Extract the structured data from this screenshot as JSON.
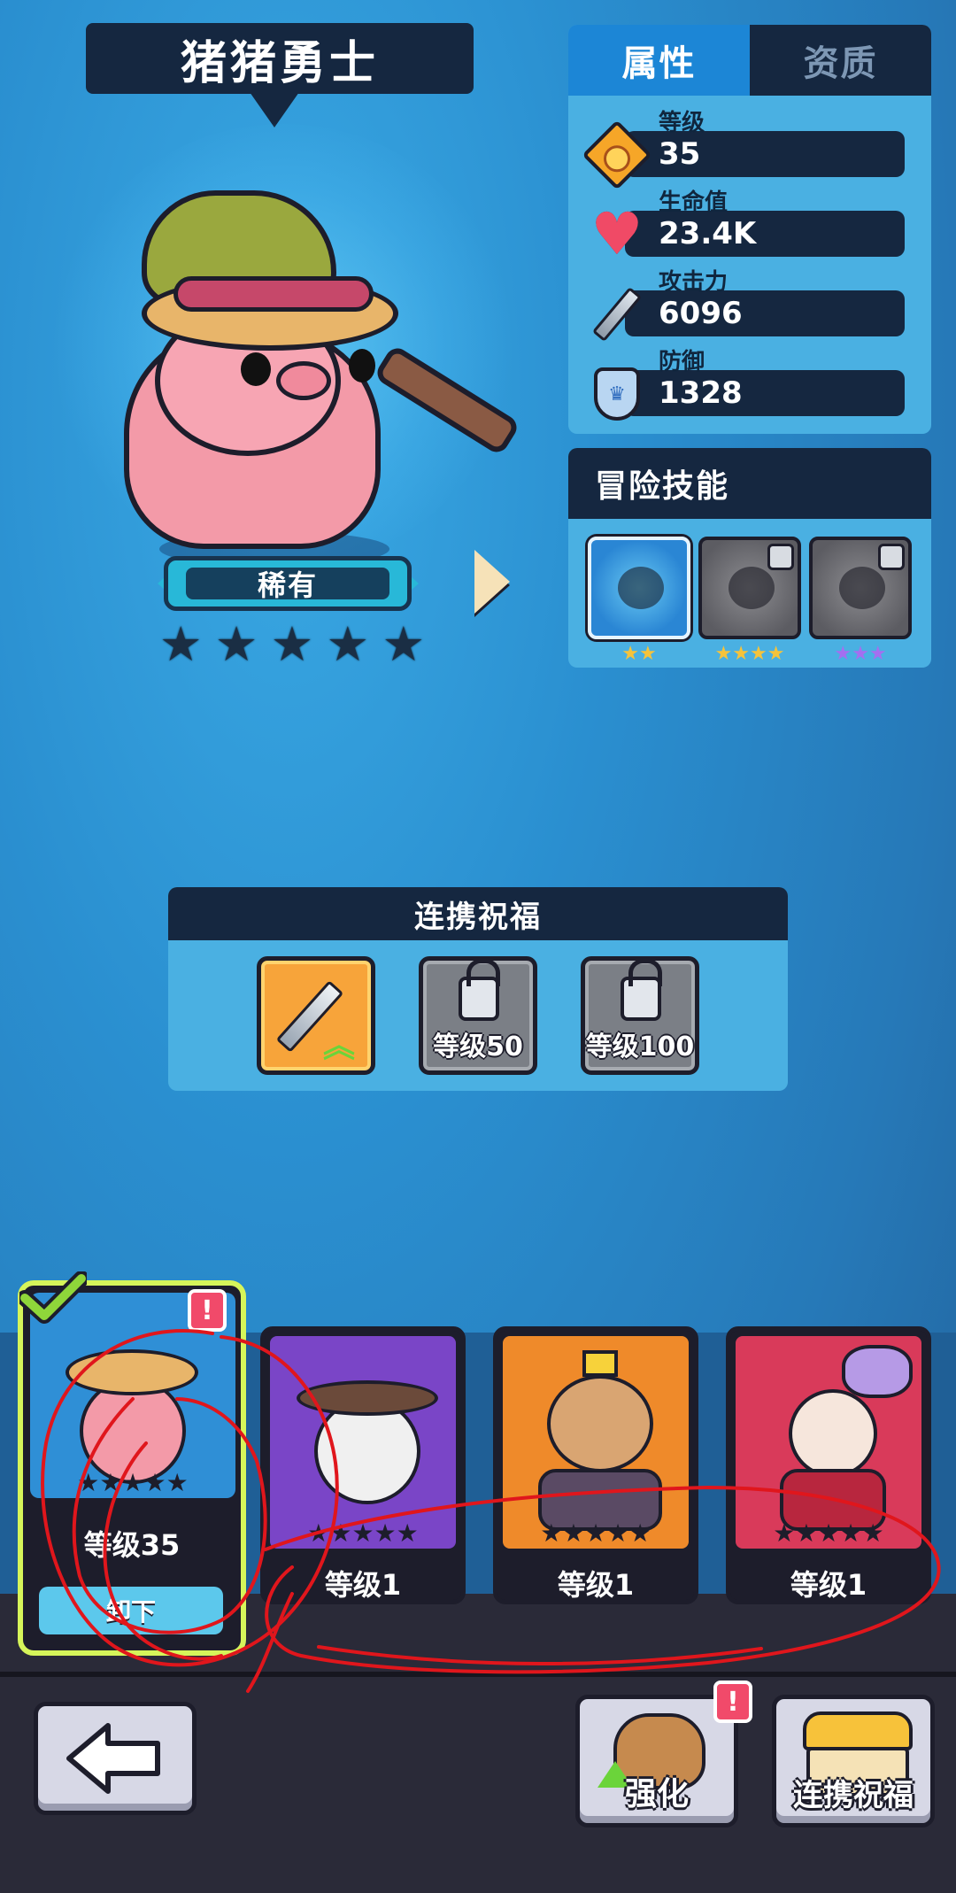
{
  "hero": {
    "name": "猪猪勇士",
    "rarity": "稀有",
    "stars_filled": 0,
    "stars_total": 5
  },
  "attributes": {
    "tabs": [
      {
        "label": "属性",
        "active": true
      },
      {
        "label": "资质",
        "active": false
      }
    ],
    "stats": [
      {
        "label": "等级",
        "value": "35",
        "icon": "level-badge-icon"
      },
      {
        "label": "生命值",
        "value": "23.4K",
        "icon": "heart-icon"
      },
      {
        "label": "攻击力",
        "value": "6096",
        "icon": "sword-icon"
      },
      {
        "label": "防御",
        "value": "1328",
        "icon": "shield-icon"
      }
    ]
  },
  "skills": {
    "title": "冒险技能",
    "items": [
      {
        "name": "skill-vortex",
        "stars": "★★",
        "star_color": "#f5c33b",
        "locked": false
      },
      {
        "name": "skill-dash",
        "stars": "★★★★",
        "star_color": "#f5c33b",
        "locked": true
      },
      {
        "name": "skill-summon",
        "stars": "★★★",
        "star_color": "#a46ff0",
        "locked": true
      }
    ]
  },
  "combo": {
    "title": "连携祝福",
    "slots": [
      {
        "type": "active",
        "label": ""
      },
      {
        "type": "locked",
        "label": "等级50"
      },
      {
        "type": "locked",
        "label": "等级100"
      }
    ]
  },
  "roster": {
    "cards": [
      {
        "name": "pig-warrior",
        "level": "等级35",
        "selected": true,
        "alert": true,
        "bg": "#2f8fd6",
        "action": "卸下"
      },
      {
        "name": "panda-ninja",
        "level": "等级1",
        "selected": false,
        "alert": false,
        "bg": "#7a45c7"
      },
      {
        "name": "bear-king",
        "level": "等级1",
        "selected": false,
        "alert": false,
        "bg": "#ef8a2a"
      },
      {
        "name": "dragon-girl",
        "level": "等级1",
        "selected": false,
        "alert": false,
        "bg": "#d93a5a"
      }
    ]
  },
  "bottom_bar": {
    "enhance_label": "强化",
    "combo_label": "连携祝福",
    "enhance_alert": "!",
    "card_alert": "!"
  },
  "colors": {
    "panel_dark": "#152740",
    "panel_light": "#4ab0e2",
    "tab_active": "#1c86d6",
    "annotation": "#e0161c"
  }
}
